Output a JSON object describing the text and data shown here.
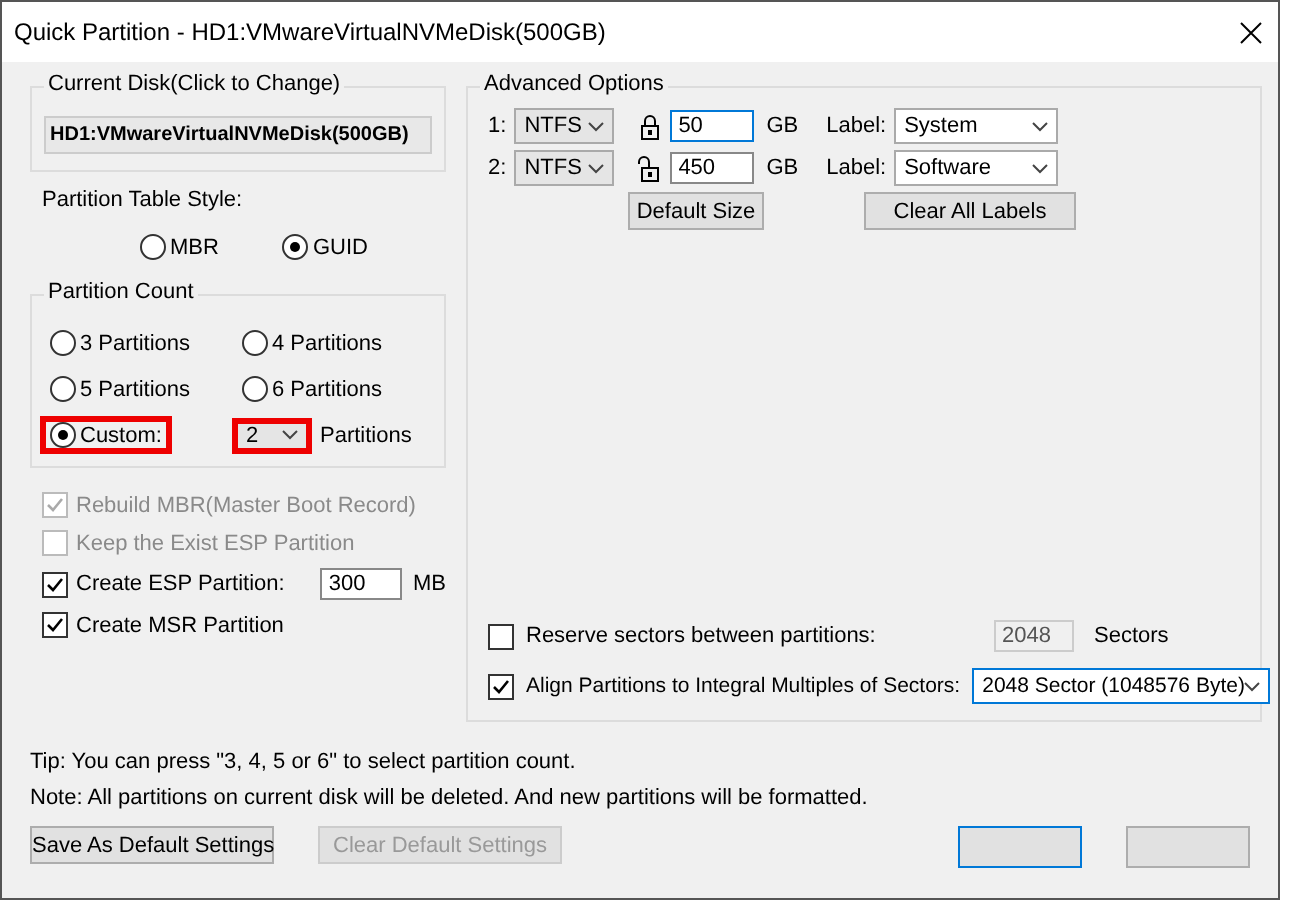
{
  "window": {
    "title": "Quick Partition - HD1:VMwareVirtualNVMeDisk(500GB)"
  },
  "current_disk": {
    "label": "Current Disk(Click to Change)",
    "value": "HD1:VMwareVirtualNVMeDisk(500GB)"
  },
  "partition_table_style": {
    "label": "Partition Table Style:",
    "options": [
      {
        "label": "MBR",
        "selected": false
      },
      {
        "label": "GUID",
        "selected": true
      }
    ]
  },
  "partition_count": {
    "label": "Partition Count",
    "options": [
      {
        "label": "3 Partitions",
        "selected": false
      },
      {
        "label": "4 Partitions",
        "selected": false
      },
      {
        "label": "5 Partitions",
        "selected": false
      },
      {
        "label": "6 Partitions",
        "selected": false
      }
    ],
    "custom": {
      "label": "Custom:",
      "selected": true,
      "highlighted": true
    },
    "custom_count": {
      "value": "2",
      "highlighted": true
    },
    "suffix": "Partitions"
  },
  "options": [
    {
      "kind": "check",
      "label": "Rebuild MBR(Master Boot Record)",
      "checked": true,
      "disabled": true
    },
    {
      "kind": "check",
      "label": "Keep the Exist ESP Partition",
      "checked": false,
      "disabled": true
    },
    {
      "kind": "input",
      "label": "Create ESP Partition:",
      "checked": true,
      "disabled": false,
      "value": "300",
      "unit": "MB"
    },
    {
      "kind": "check",
      "label": "Create MSR Partition",
      "checked": true,
      "disabled": false
    }
  ],
  "advanced": {
    "title": "Advanced Options",
    "rows": [
      {
        "index": "1:",
        "filesystem": "NTFS",
        "locked": true,
        "size": "50",
        "unit": "GB",
        "label_caption": "Label:",
        "label": "System",
        "focused": true
      },
      {
        "index": "2:",
        "filesystem": "NTFS",
        "locked": false,
        "size": "450",
        "unit": "GB",
        "label_caption": "Label:",
        "label": "Software",
        "focused": false
      }
    ],
    "default_size_button": "Default Size",
    "clear_labels_button": "Clear All Labels",
    "reserve": {
      "label": "Reserve sectors between partitions:",
      "checked": false,
      "value": "2048",
      "unit": "Sectors"
    },
    "align": {
      "label": "Align Partitions to Integral Multiples of Sectors:",
      "checked": true,
      "value": "2048 Sector (1048576 Byte)"
    }
  },
  "tip": "Tip:  You can press \"3, 4, 5 or 6\" to select partition count.",
  "note": "Note: All partitions on current disk will be deleted. And new partitions will be formatted.",
  "buttons": [
    {
      "label": "Save As Default Settings",
      "disabled": false
    },
    {
      "label": "Clear Default Settings",
      "disabled": true
    }
  ]
}
